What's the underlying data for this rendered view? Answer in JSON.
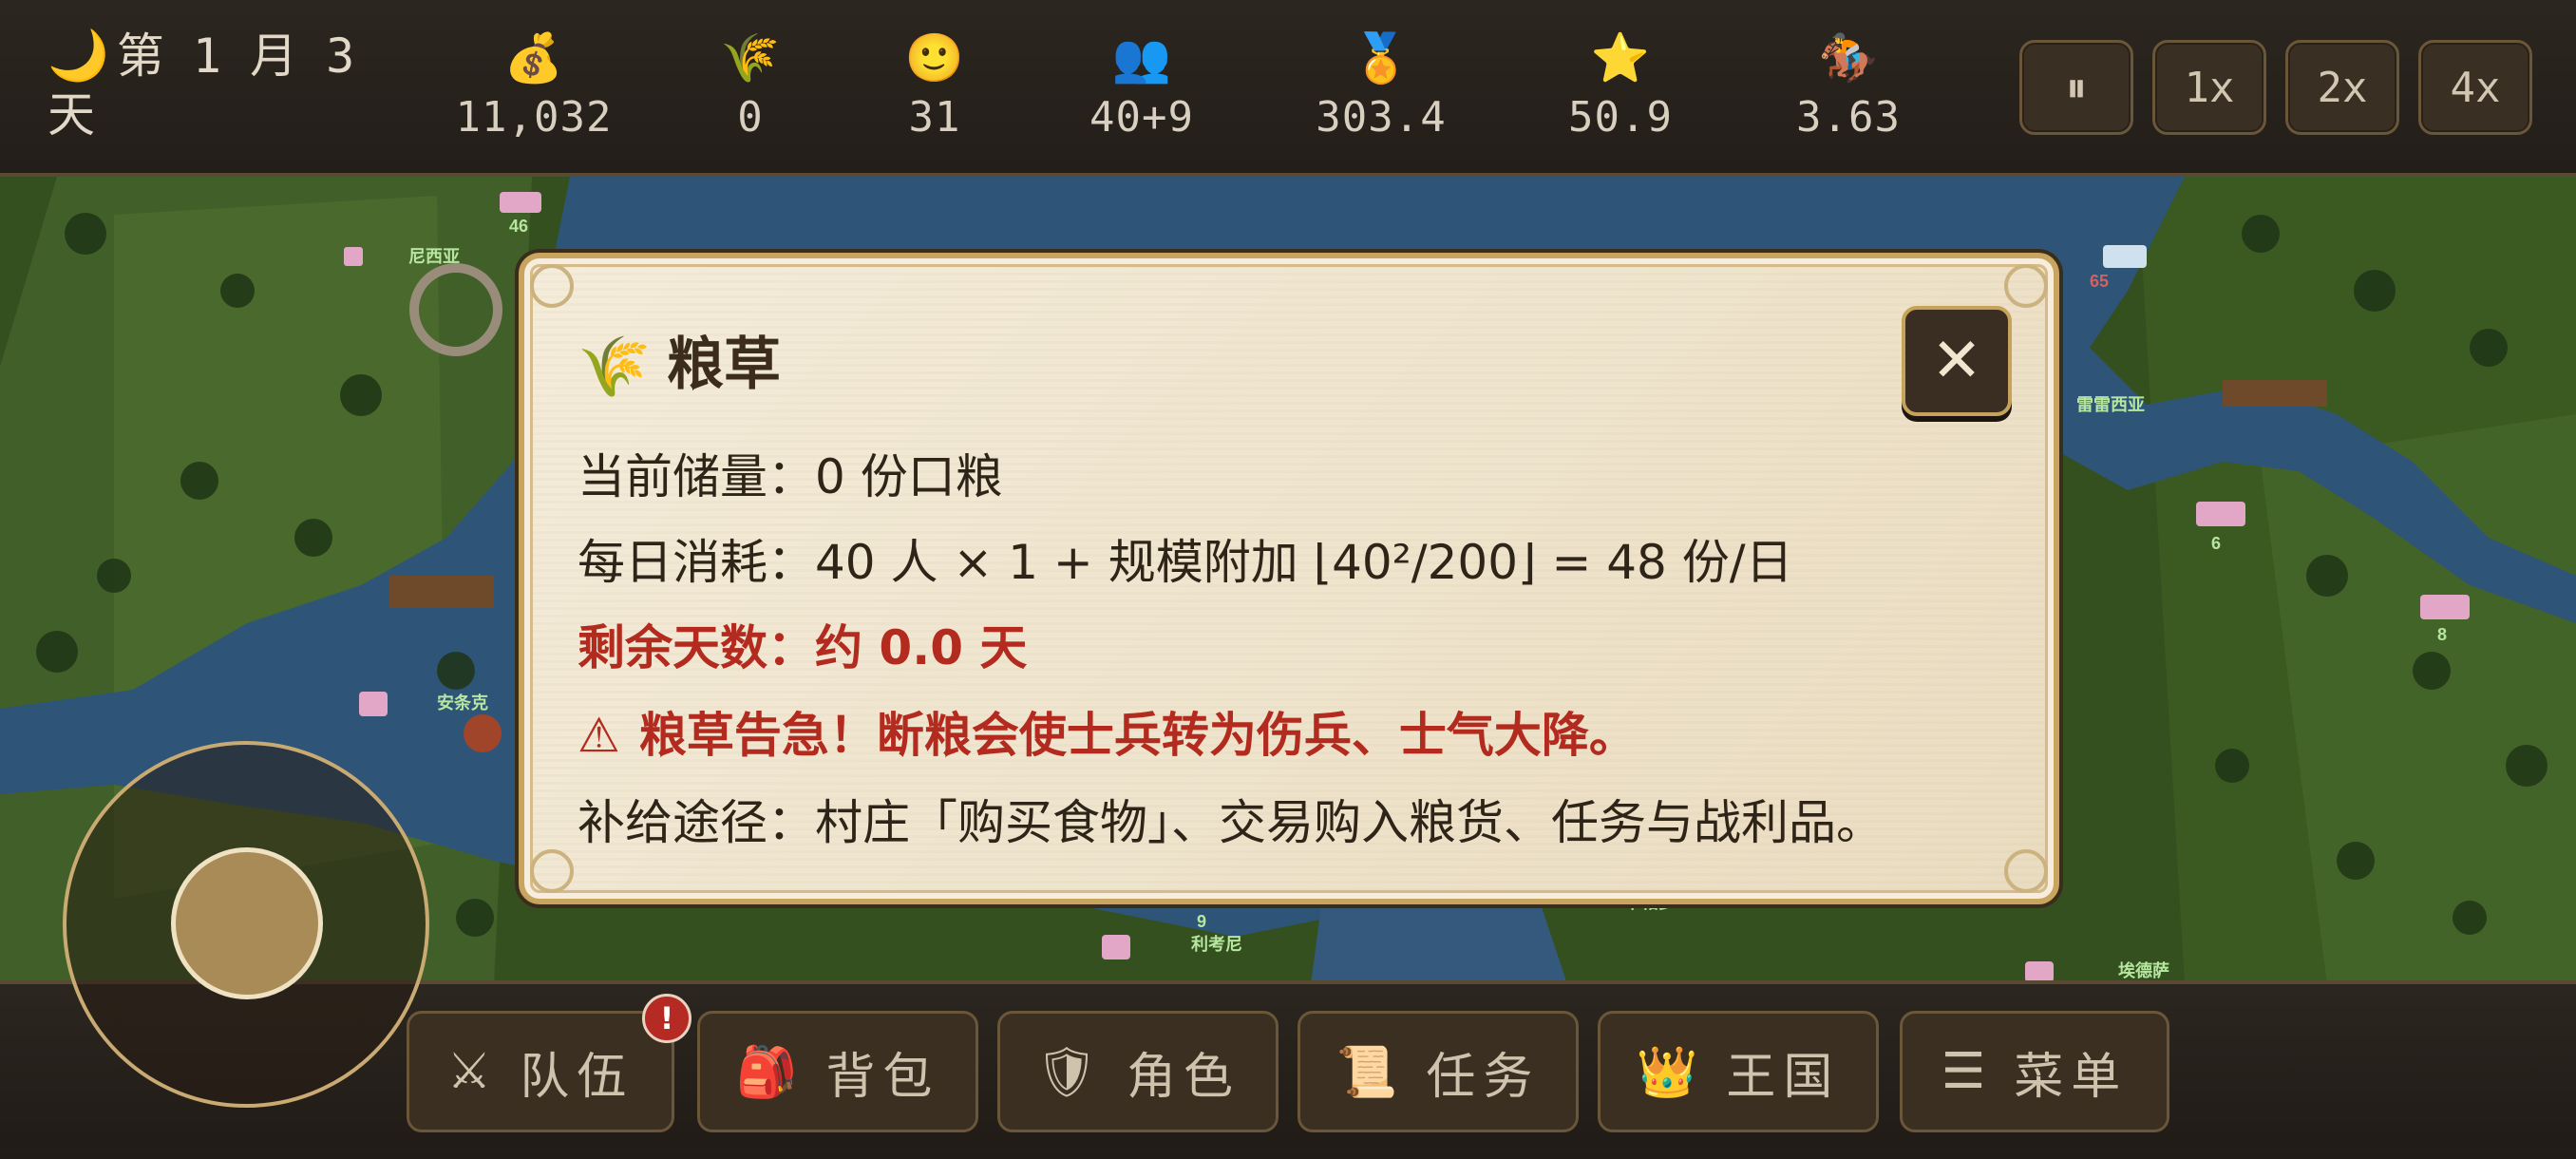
{
  "hud": {
    "date_line1": "第 1 月 3",
    "date_line2": "天",
    "stats": [
      {
        "icon": "money-bag-icon",
        "glyph": "💰",
        "value": "11,032"
      },
      {
        "icon": "grain-icon",
        "glyph": "🌾",
        "value": "0"
      },
      {
        "icon": "smile-icon",
        "glyph": "🙂",
        "value": "31"
      },
      {
        "icon": "people-icon",
        "glyph": "👥",
        "value": "40+9"
      },
      {
        "icon": "medal-icon",
        "glyph": "🏅",
        "value": "303.4"
      },
      {
        "icon": "star-icon",
        "glyph": "⭐",
        "value": "50.9"
      },
      {
        "icon": "horse-icon",
        "glyph": "🏇",
        "value": "3.63"
      }
    ],
    "speed": {
      "pause": "⏸",
      "x1": "1x",
      "x2": "2x",
      "x4": "4x"
    }
  },
  "dialog": {
    "icon": "🌾",
    "title": "粮草",
    "close": "✕",
    "line1": "当前储量：0 份口粮",
    "line2": "每日消耗：40 人 × 1 + 规模附加 ⌊40²/200⌋ = 48 份/日",
    "line3": "剩余天数：约 0.0 天",
    "warning_icon": "⚠",
    "line4": "粮草告急！断粮会使士兵转为伤兵、士气大降。",
    "line5": "补给途径：村庄「购买食物」、交易购入粮货、任务与战利品。"
  },
  "nav": {
    "badge": "!",
    "items": [
      {
        "icon": "⚔",
        "label": "队伍"
      },
      {
        "icon": "🎒",
        "label": "背包"
      },
      {
        "icon": "🛡",
        "label": "角色"
      },
      {
        "icon": "📜",
        "label": "任务"
      },
      {
        "icon": "👑",
        "label": "王国"
      },
      {
        "icon": "☰",
        "label": "菜单"
      }
    ]
  },
  "map_labels": [
    "46",
    "尼西亚",
    "65",
    "雷雷西亚",
    "6",
    "8",
    "安条克",
    "9",
    "利考尼",
    "卡帕多",
    "埃德萨"
  ],
  "colors": {
    "accent": "#c8a45e",
    "danger": "#b32a1f",
    "panel": "#2c2620"
  }
}
